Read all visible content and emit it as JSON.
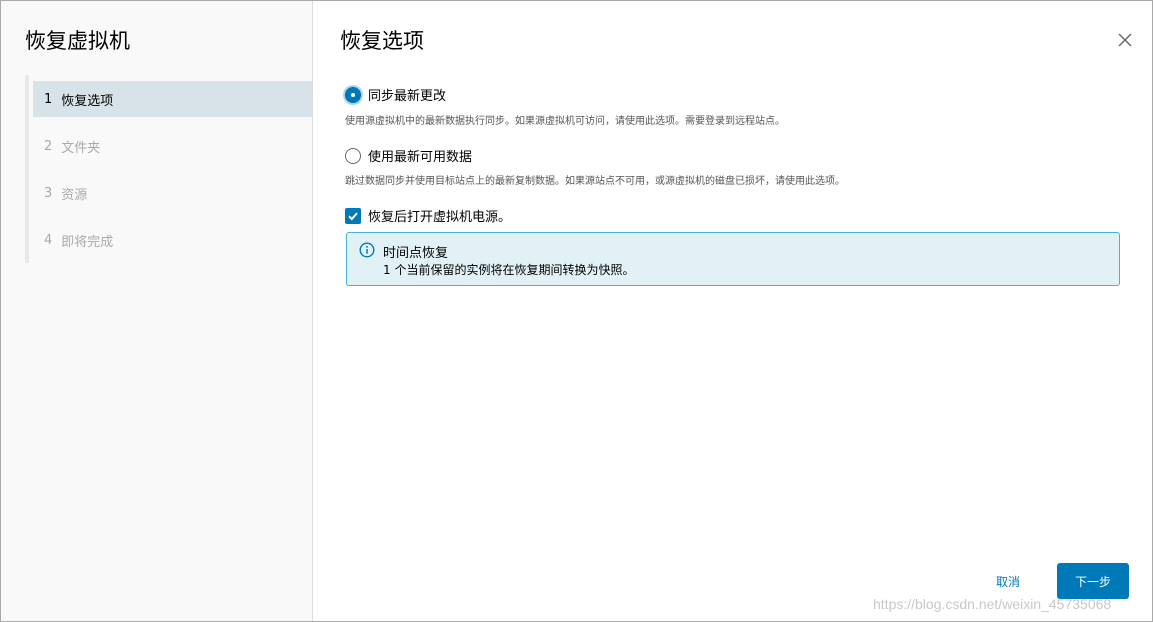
{
  "wizard": {
    "title": "恢复虚拟机",
    "steps": [
      {
        "num": "1",
        "label": "恢复选项",
        "active": true
      },
      {
        "num": "2",
        "label": "文件夹",
        "active": false
      },
      {
        "num": "3",
        "label": "资源",
        "active": false
      },
      {
        "num": "4",
        "label": "即将完成",
        "active": false
      }
    ]
  },
  "page": {
    "title": "恢复选项",
    "close_icon": "close-icon"
  },
  "options": {
    "sync_latest": {
      "label": "同步最新更改",
      "description": "使用源虚拟机中的最新数据执行同步。如果源虚拟机可访问，请使用此选项。需要登录到远程站点。",
      "selected": true
    },
    "use_latest": {
      "label": "使用最新可用数据",
      "description": "跳过数据同步并使用目标站点上的最新复制数据。如果源站点不可用，或源虚拟机的磁盘已损坏，请使用此选项。",
      "selected": false
    },
    "power_on": {
      "label": "恢复后打开虚拟机电源。",
      "checked": true
    }
  },
  "alert": {
    "icon": "info-icon",
    "title": "时间点恢复",
    "text": "1 个当前保留的实例将在恢复期间转换为快照。"
  },
  "footer": {
    "cancel_label": "取消",
    "next_label": "下一步"
  },
  "watermark": "https://blog.csdn.net/weixin_45735068",
  "colors": {
    "accent": "#0079b8",
    "alert_bg": "#e1f1f6",
    "alert_border": "#49afd9",
    "active_step_bg": "#d8e3e9"
  }
}
